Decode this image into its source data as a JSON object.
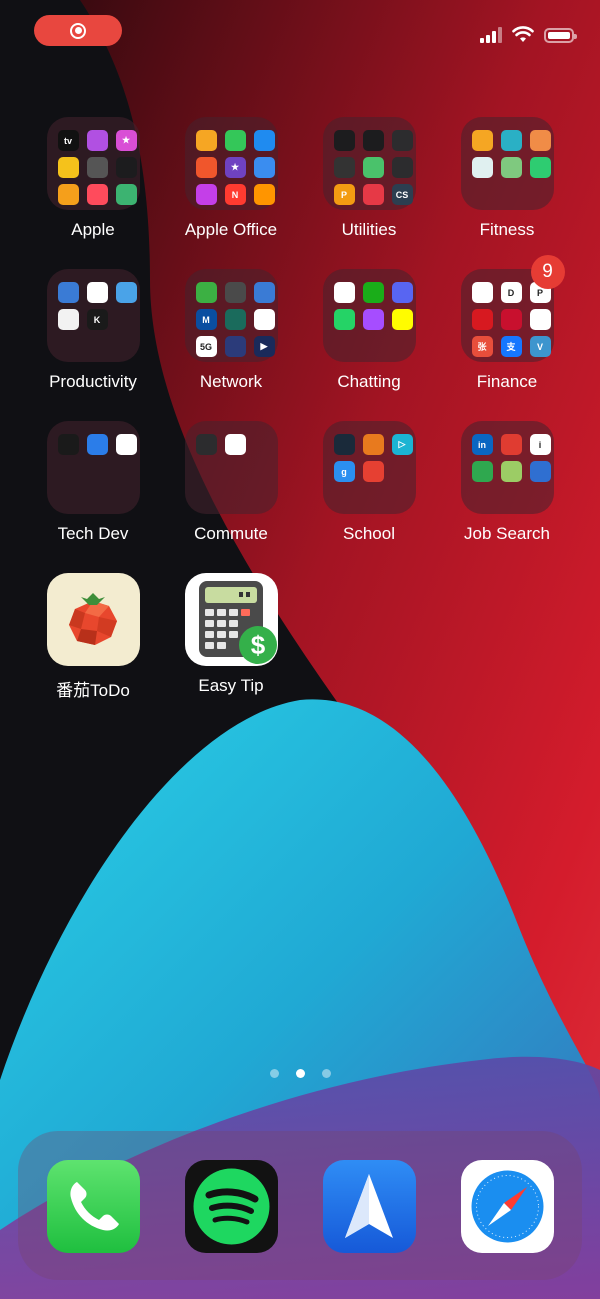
{
  "status_bar": {
    "recording_icon": "screen-recording-icon",
    "signal_icon": "cellular-signal-icon",
    "wifi_icon": "wifi-icon",
    "battery_icon": "battery-icon"
  },
  "folders": [
    {
      "label": "Apple",
      "badge": null,
      "minis": [
        {
          "icon": "apple-tv",
          "color": "#111111",
          "text": "tv"
        },
        {
          "icon": "podcasts",
          "color": "#b150e2",
          "text": ""
        },
        {
          "icon": "itunes-store",
          "color": "#d94fd6",
          "text": "★"
        },
        {
          "icon": "tips",
          "color": "#f5c21b",
          "text": ""
        },
        {
          "icon": "find-my",
          "color": "#555555",
          "text": ""
        },
        {
          "icon": "watch",
          "color": "#1c1c1e",
          "text": ""
        },
        {
          "icon": "home",
          "color": "#f59f1b",
          "text": ""
        },
        {
          "icon": "shortcuts",
          "color": "#ff4b5c",
          "text": ""
        },
        {
          "icon": "activity",
          "color": "#3cb371",
          "text": ""
        }
      ]
    },
    {
      "label": "Apple Office",
      "badge": null,
      "minis": [
        {
          "icon": "pages",
          "color": "#f6a623",
          "text": ""
        },
        {
          "icon": "numbers",
          "color": "#34c759",
          "text": ""
        },
        {
          "icon": "keynote",
          "color": "#1f8bf0",
          "text": ""
        },
        {
          "icon": "garageband",
          "color": "#f0562c",
          "text": ""
        },
        {
          "icon": "imovie",
          "color": "#6f42c1",
          "text": "★"
        },
        {
          "icon": "clips",
          "color": "#3a8df0",
          "text": ""
        },
        {
          "icon": "itunes-u",
          "color": "#c43fe8",
          "text": ""
        },
        {
          "icon": "news",
          "color": "#ff3b30",
          "text": "N"
        },
        {
          "icon": "books",
          "color": "#ff9500",
          "text": ""
        }
      ]
    },
    {
      "label": "Utilities",
      "badge": null,
      "minis": [
        {
          "icon": "voice-memos",
          "color": "#1c1c1e",
          "text": ""
        },
        {
          "icon": "compass",
          "color": "#1c1c1e",
          "text": ""
        },
        {
          "icon": "measure",
          "color": "#2c2c2e",
          "text": ""
        },
        {
          "icon": "calculator",
          "color": "#333333",
          "text": ""
        },
        {
          "icon": "wechat-helper",
          "color": "#4ac26b",
          "text": ""
        },
        {
          "icon": "translate",
          "color": "#2c2c2e",
          "text": ""
        },
        {
          "icon": "pinterest",
          "color": "#f39c12",
          "text": "P"
        },
        {
          "icon": "scanner",
          "color": "#e63946",
          "text": ""
        },
        {
          "icon": "camscanner",
          "color": "#2c3e50",
          "text": "CS"
        }
      ]
    },
    {
      "label": "Fitness",
      "badge": null,
      "minis": [
        {
          "icon": "myfitnesspal",
          "color": "#f5a623",
          "text": ""
        },
        {
          "icon": "nike-run",
          "color": "#2ab0c5",
          "text": ""
        },
        {
          "icon": "keep",
          "color": "#f08c47",
          "text": ""
        },
        {
          "icon": "fitbit",
          "color": "#e0f0f0",
          "text": ""
        },
        {
          "icon": "yoga",
          "color": "#7fc97f",
          "text": ""
        },
        {
          "icon": "cycling",
          "color": "#2ecc71",
          "text": ""
        }
      ]
    },
    {
      "label": "Productivity",
      "badge": null,
      "minis": [
        {
          "icon": "pencil",
          "color": "#3a7bd5",
          "text": ""
        },
        {
          "icon": "dice",
          "color": "#ffffff",
          "text": ""
        },
        {
          "icon": "bookmark",
          "color": "#4aa3e8",
          "text": ""
        },
        {
          "icon": "notes",
          "color": "#f2f2f2",
          "text": ""
        },
        {
          "icon": "kindle",
          "color": "#1a1a1a",
          "text": "K"
        }
      ]
    },
    {
      "label": "Network",
      "badge": null,
      "minis": [
        {
          "icon": "speedtest-green",
          "color": "#3cb043",
          "text": ""
        },
        {
          "icon": "speedometer",
          "color": "#4a4a4a",
          "text": ""
        },
        {
          "icon": "vpn-globe",
          "color": "#3a7bd5",
          "text": ""
        },
        {
          "icon": "m-app",
          "color": "#0a4ea1",
          "text": "M"
        },
        {
          "icon": "umbrella",
          "color": "#1a6b5c",
          "text": ""
        },
        {
          "icon": "connect",
          "color": "#ffffff",
          "text": ""
        },
        {
          "icon": "5g-speed",
          "color": "#ffffff",
          "text": "5G"
        },
        {
          "icon": "contacts",
          "color": "#2b3b7a",
          "text": ""
        },
        {
          "icon": "play",
          "color": "#1a2a5a",
          "text": "▶"
        }
      ]
    },
    {
      "label": "Chatting",
      "badge": null,
      "minis": [
        {
          "icon": "qq",
          "color": "#ffffff",
          "text": ""
        },
        {
          "icon": "wechat",
          "color": "#1aad19",
          "text": ""
        },
        {
          "icon": "discord",
          "color": "#5865f2",
          "text": ""
        },
        {
          "icon": "whatsapp",
          "color": "#25d366",
          "text": ""
        },
        {
          "icon": "messenger",
          "color": "#a64dff",
          "text": ""
        },
        {
          "icon": "snapchat",
          "color": "#fffc00",
          "text": ""
        }
      ]
    },
    {
      "label": "Finance",
      "badge": "9",
      "minis": [
        {
          "icon": "bank-of-america",
          "color": "#ffffff",
          "text": ""
        },
        {
          "icon": "digital-bank",
          "color": "#ffffff",
          "text": "D"
        },
        {
          "icon": "paypal",
          "color": "#ffffff",
          "text": "P"
        },
        {
          "icon": "icbc",
          "color": "#d71920",
          "text": ""
        },
        {
          "icon": "boc",
          "color": "#c8102e",
          "text": ""
        },
        {
          "icon": "weibo-pay",
          "color": "#ffffff",
          "text": ""
        },
        {
          "icon": "zhangxin",
          "color": "#e84e3b",
          "text": "张"
        },
        {
          "icon": "alipay",
          "color": "#1677ff",
          "text": "支"
        },
        {
          "icon": "venmo",
          "color": "#3d95ce",
          "text": "V"
        }
      ]
    },
    {
      "label": "Tech Dev",
      "badge": null,
      "minis": [
        {
          "icon": "github",
          "color": "#1a1a1a",
          "text": ""
        },
        {
          "icon": "testflight",
          "color": "#2b7de9",
          "text": ""
        },
        {
          "icon": "cursor-app",
          "color": "#ffffff",
          "text": ""
        }
      ]
    },
    {
      "label": "Commute",
      "badge": null,
      "minis": [
        {
          "icon": "transit-card",
          "color": "#2c2c2e",
          "text": ""
        },
        {
          "icon": "metro",
          "color": "#ffffff",
          "text": ""
        }
      ]
    },
    {
      "label": "School",
      "badge": null,
      "minis": [
        {
          "icon": "webex",
          "color": "#1a2a3a",
          "text": ""
        },
        {
          "icon": "pencil-ruler",
          "color": "#e87a1e",
          "text": ""
        },
        {
          "icon": "video-play",
          "color": "#1bb4d3",
          "text": "▷"
        },
        {
          "icon": "grammarly",
          "color": "#2b8ff0",
          "text": "g"
        },
        {
          "icon": "canvas",
          "color": "#e64032",
          "text": ""
        }
      ]
    },
    {
      "label": "Job Search",
      "badge": null,
      "minis": [
        {
          "icon": "linkedin",
          "color": "#0a66c2",
          "text": "in"
        },
        {
          "icon": "handshake",
          "color": "#e03c31",
          "text": ""
        },
        {
          "icon": "indeed",
          "color": "#ffffff",
          "text": "i"
        },
        {
          "icon": "boss-zhipin",
          "color": "#2fa84f",
          "text": ""
        },
        {
          "icon": "lagou",
          "color": "#9ccc65",
          "text": ""
        },
        {
          "icon": "zhilian",
          "color": "#2f6fd1",
          "text": ""
        }
      ]
    }
  ],
  "apps": [
    {
      "label": "番茄ToDo",
      "icon": "tomato-icon"
    },
    {
      "label": "Easy Tip",
      "icon": "calculator-dollar-icon"
    }
  ],
  "page_dots": {
    "count": 3,
    "active": 1
  },
  "dock": [
    {
      "name": "phone-app-icon",
      "color": "#36c75a"
    },
    {
      "name": "spotify-app-icon",
      "color": "#121212"
    },
    {
      "name": "spark-mail-app-icon",
      "color": "#1f6fe0"
    },
    {
      "name": "safari-app-icon",
      "color": "#ffffff"
    }
  ]
}
